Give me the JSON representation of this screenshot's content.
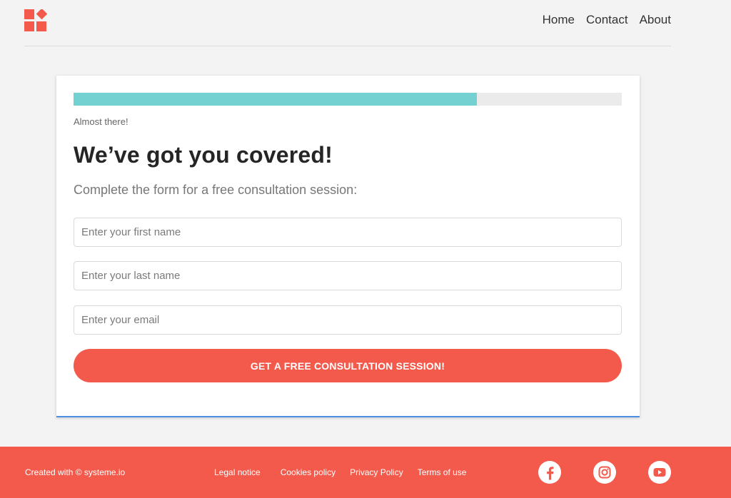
{
  "header": {
    "logo_icon": "brand-shapes-icon",
    "nav": [
      "Home",
      "Contact",
      "About"
    ]
  },
  "form": {
    "progress": {
      "label": "Almost there!",
      "fraction": 0.736,
      "fill_color": "#74d1d2",
      "track_color": "#ebebeb"
    },
    "headline": "We’ve got you covered!",
    "subheadline": "Complete the form for a free consultation session:",
    "fields": {
      "first_name": {
        "placeholder": "Enter your first name",
        "value": ""
      },
      "last_name": {
        "placeholder": "Enter your last name",
        "value": ""
      },
      "email": {
        "placeholder": "Enter your email",
        "value": ""
      }
    },
    "submit_label": "GET A FREE CONSULTATION SESSION!"
  },
  "footer": {
    "credit": "Created with © systeme.io",
    "links": [
      "Legal notice",
      "Cookies policy",
      "Privacy Policy",
      "Terms of use"
    ],
    "social_icons": [
      "facebook-icon",
      "instagram-icon",
      "youtube-icon"
    ]
  },
  "colors": {
    "accent": "#f35a4b",
    "progress": "#74d1d2",
    "card_bottom_border": "#4a90e2"
  }
}
